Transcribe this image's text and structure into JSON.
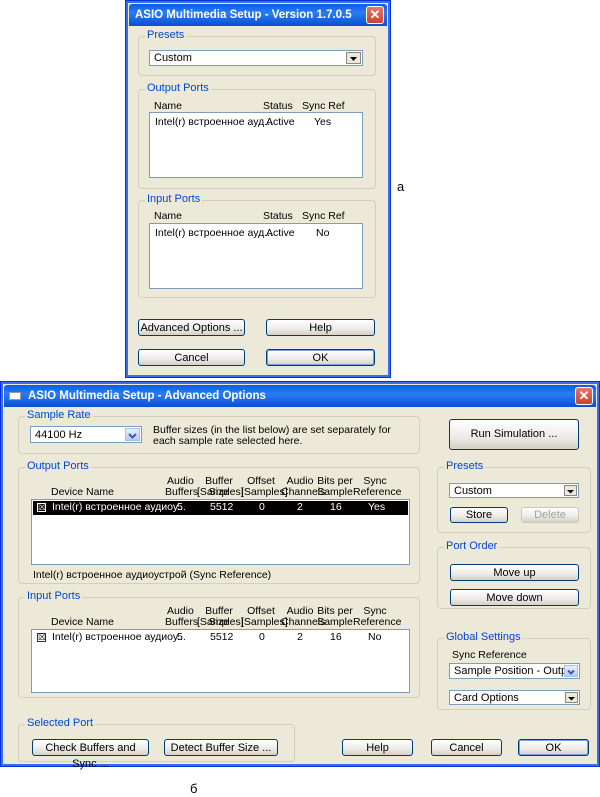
{
  "dialog_a": {
    "title": "ASIO Multimedia Setup  -  Version 1.7.0.5",
    "presets": {
      "label": "Presets",
      "value": "Custom"
    },
    "output_ports": {
      "label": "Output Ports",
      "headers": [
        "Name",
        "Status",
        "Sync Ref"
      ],
      "rows": [
        {
          "name": "Intel(r) встроенное ауд...",
          "status": "Active",
          "sync": "Yes"
        }
      ]
    },
    "input_ports": {
      "label": "Input Ports",
      "headers": [
        "Name",
        "Status",
        "Sync Ref"
      ],
      "rows": [
        {
          "name": "Intel(r) встроенное ауд...",
          "status": "Active",
          "sync": "No"
        }
      ]
    },
    "buttons": {
      "advanced": "Advanced Options ...",
      "help": "Help",
      "cancel": "Cancel",
      "ok": "OK"
    }
  },
  "caption_a": "а",
  "dialog_b": {
    "title": "ASIO Multimedia Setup  - Advanced Options",
    "sample_rate": {
      "label": "Sample Rate",
      "value": "44100 Hz",
      "note": "Buffer sizes (in the list below) are set separately for each sample rate selected here."
    },
    "run_simulation": "Run Simulation ...",
    "port_headers": {
      "device": "Device Name",
      "audio_buffers": [
        "Audio",
        "Buffers"
      ],
      "buffer_size": [
        "Buffer Size",
        "[Samples]"
      ],
      "offset": [
        "Offset",
        "[Samples]"
      ],
      "channels": [
        "Audio",
        "Channels"
      ],
      "bits": [
        "Bits per",
        "Sample"
      ],
      "sync": [
        "Sync",
        "Reference"
      ]
    },
    "output_ports": {
      "label": "Output Ports",
      "rows": [
        {
          "checked": "☒",
          "name": "Intel(r) встроенное аудиоу...",
          "buffers": "5",
          "size": "5512",
          "offset": "0",
          "channels": "2",
          "bits": "16",
          "sync": "Yes"
        }
      ],
      "status": "Intel(r) встроенное аудиоустрой (Sync Reference)"
    },
    "input_ports": {
      "label": "Input Ports",
      "rows": [
        {
          "checked": "☒",
          "name": "Intel(r) встроенное аудиоу...",
          "buffers": "5",
          "size": "5512",
          "offset": "0",
          "channels": "2",
          "bits": "16",
          "sync": "No"
        }
      ]
    },
    "presets": {
      "label": "Presets",
      "value": "Custom",
      "store": "Store",
      "delete": "Delete"
    },
    "port_order": {
      "label": "Port Order",
      "move_up": "Move up",
      "move_down": "Move down"
    },
    "global_settings": {
      "label": "Global Settings",
      "sync_label": "Sync Reference",
      "sync_value": "Sample Position - Output",
      "card_options": "Card Options"
    },
    "selected_port": {
      "label": "Selected Port",
      "check_buffers": "Check Buffers and Sync ...",
      "detect_buffer": "Detect Buffer Size ..."
    },
    "buttons": {
      "help": "Help",
      "cancel": "Cancel",
      "ok": "OK"
    }
  },
  "caption_b": "б"
}
